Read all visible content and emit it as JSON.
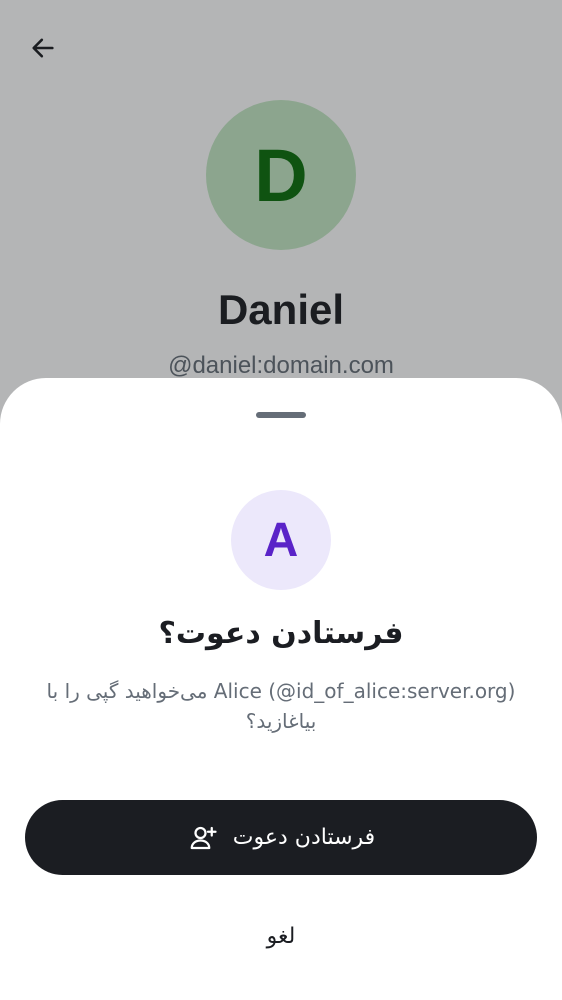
{
  "profile": {
    "avatar_letter": "D",
    "name": "Daniel",
    "user_id": "@daniel:domain.com",
    "back_icon": "arrow-left-icon"
  },
  "invite_sheet": {
    "avatar_letter": "A",
    "title": "فرستادن دعوت؟",
    "description": "Alice (@id_of_alice:server.org) می‌خواهید گپی را با بیاغازید؟",
    "invite_button_label": "فرستادن دعوت",
    "invite_button_icon": "user-add-icon",
    "cancel_label": "لغو"
  },
  "colors": {
    "profile_avatar_bg": "#c4e8c4",
    "profile_avatar_text": "#0a6e0a",
    "invite_avatar_bg": "#ece8fb",
    "invite_avatar_text": "#5a23c8",
    "primary_button_bg": "#1b1d22",
    "text_primary": "#1b1d22",
    "text_secondary": "#656d77"
  }
}
